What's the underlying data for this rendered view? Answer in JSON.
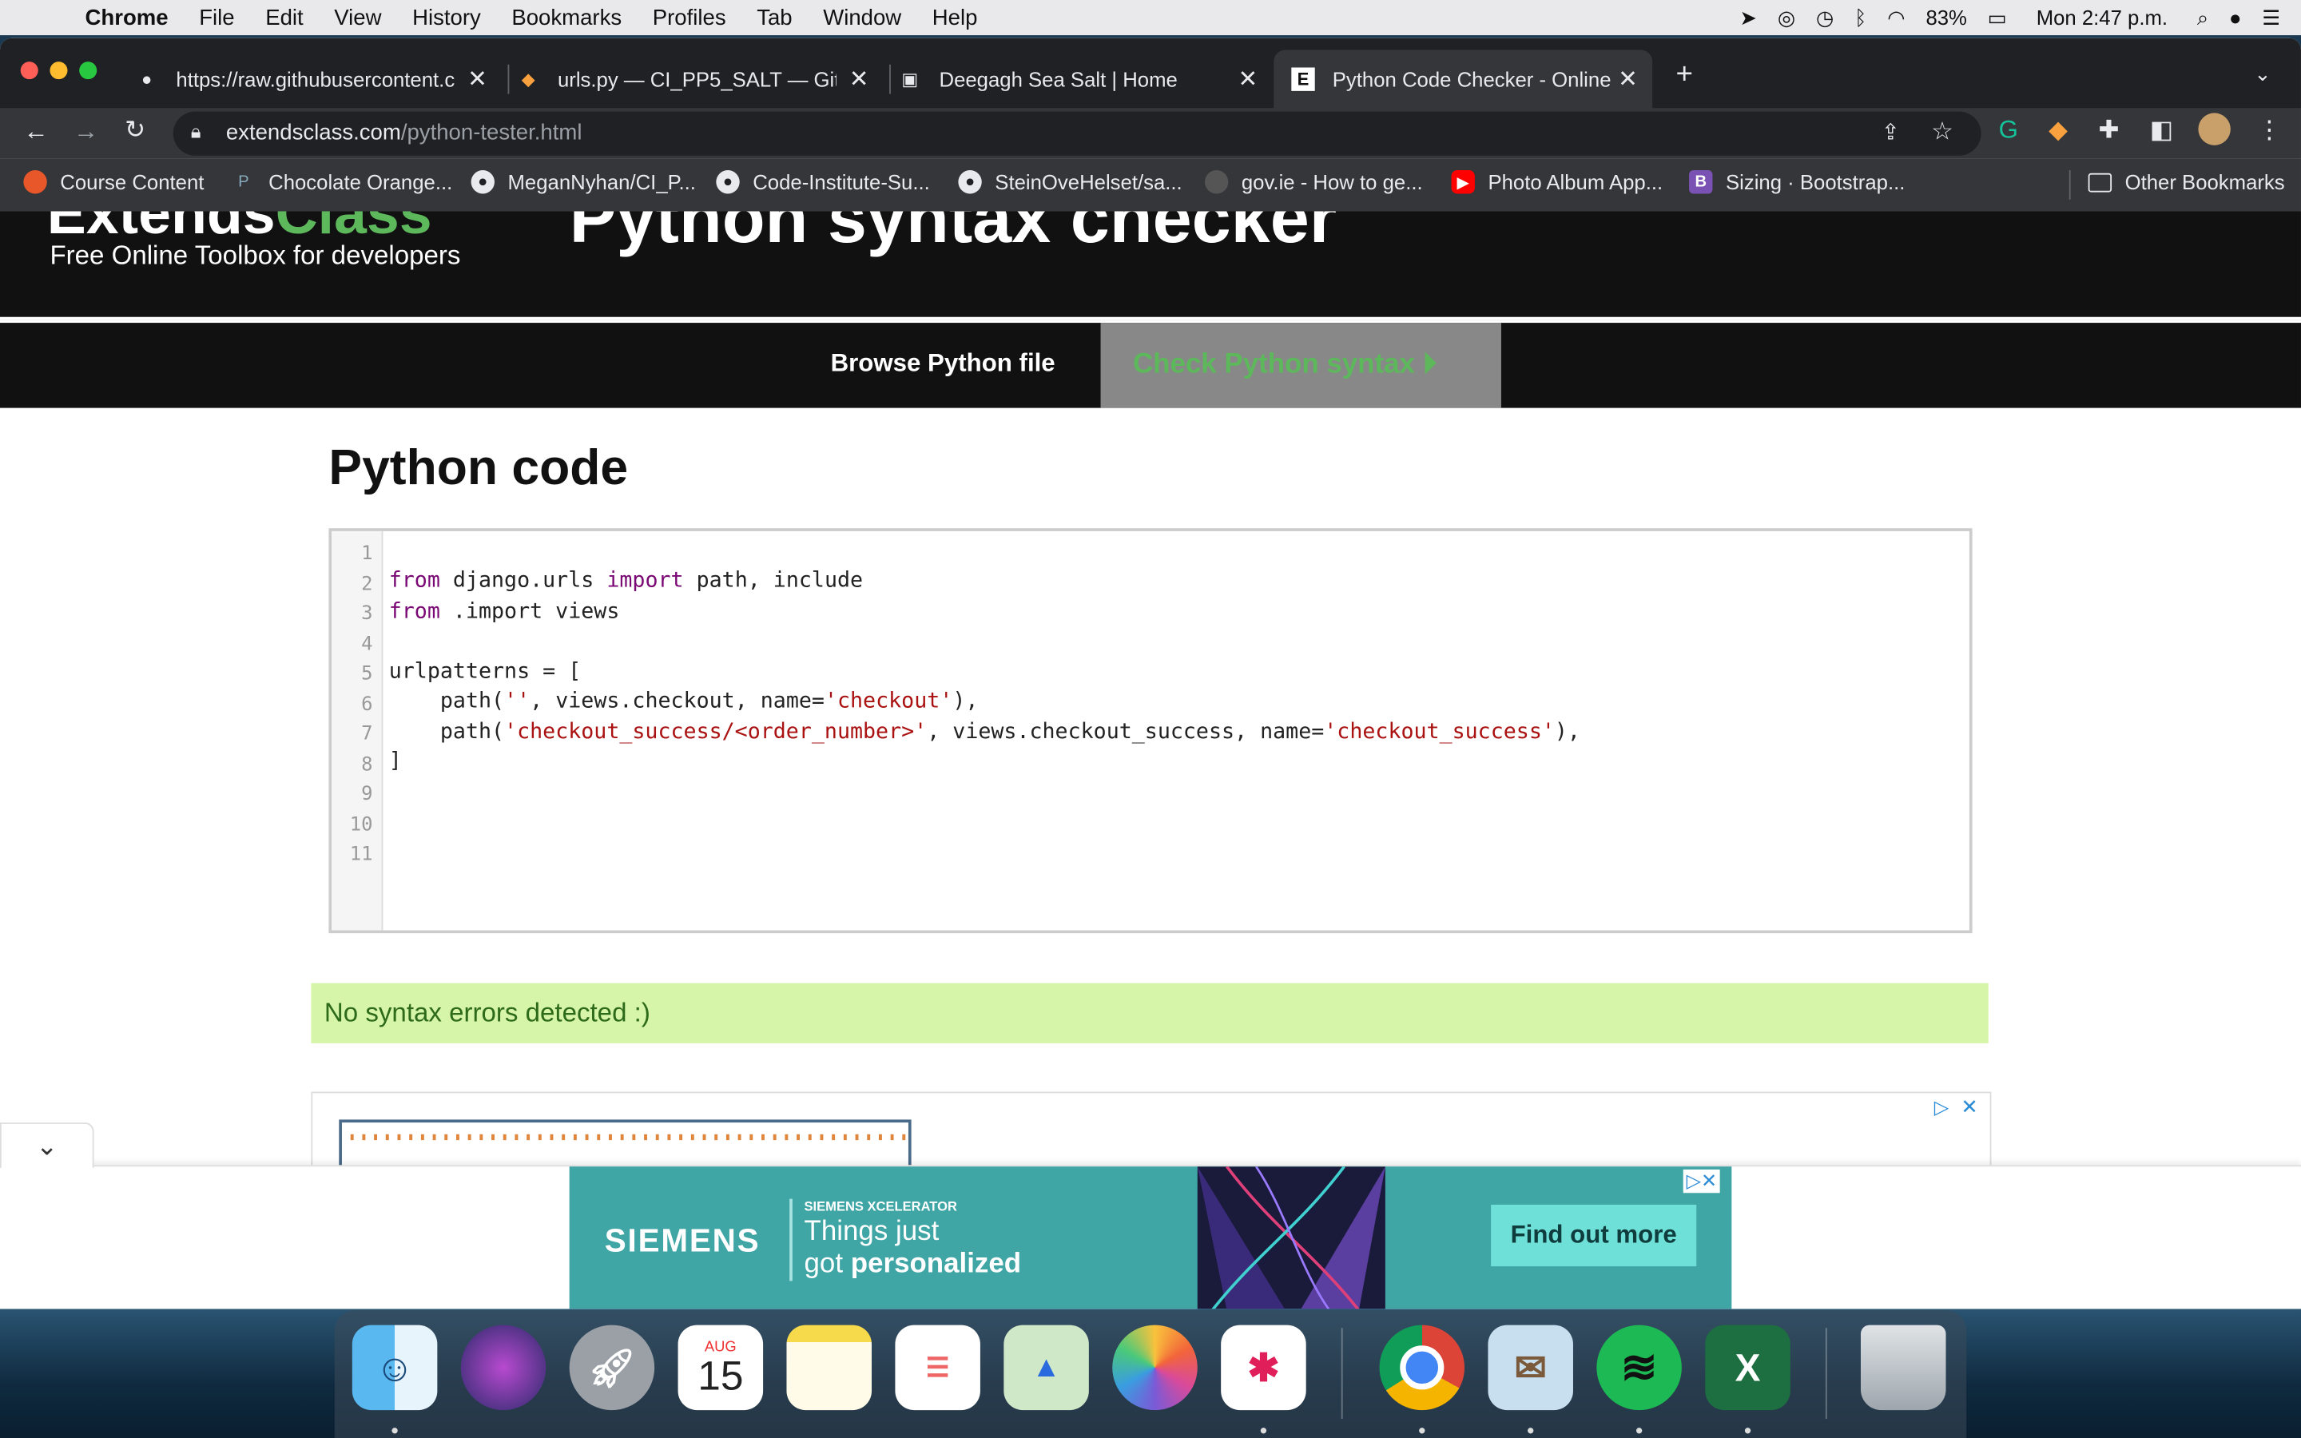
{
  "menubar": {
    "app": "Chrome",
    "items": [
      "File",
      "Edit",
      "View",
      "History",
      "Bookmarks",
      "Profiles",
      "Tab",
      "Window",
      "Help"
    ],
    "battery": "83%",
    "clock": "Mon 2:47 p.m."
  },
  "tabs": [
    {
      "title": "https://raw.githubusercontent.c",
      "icon": "github-icon"
    },
    {
      "title": "urls.py — CI_PP5_SALT — Gitp",
      "icon": "gitpod-icon"
    },
    {
      "title": "Deegagh Sea Salt | Home",
      "icon": "page-icon"
    },
    {
      "title": "Python Code Checker - Online",
      "icon": "extendsclass-icon"
    }
  ],
  "address": {
    "domain": "extendsclass.com",
    "path": "/python-tester.html"
  },
  "bookmarks": [
    "Course Content",
    "Chocolate Orange...",
    "MeganNyhan/CI_P...",
    "Code-Institute-Su...",
    "SteinOveHelset/sa...",
    "gov.ie - How to ge...",
    "Photo Album App...",
    "Sizing · Bootstrap..."
  ],
  "other_bookmarks": "Other Bookmarks",
  "site": {
    "logo_a": "Extends",
    "logo_b": "Class",
    "tagline": "Free Online Toolbox for developers",
    "page_title": "Python syntax checker",
    "browse_label": "Browse Python file",
    "check_label": "Check Python syntax ⏵",
    "section_title": "Python code",
    "result": "No syntax errors detected :)"
  },
  "code_lines": [
    "1",
    "2",
    "3",
    "4",
    "5",
    "6",
    "7",
    "8",
    "9",
    "10",
    "11"
  ],
  "code": {
    "l2a": "from",
    "l2b": " django.urls ",
    "l2c": "import",
    "l2d": " path, include",
    "l3a": "from",
    "l3b": " .import views",
    "l5": "urlpatterns = [",
    "l6a": "    path(",
    "l6b": "''",
    "l6c": ", views.checkout, name=",
    "l6d": "'checkout'",
    "l6e": "),",
    "l7a": "    path(",
    "l7b": "'checkout_success/<order_number>'",
    "l7c": ", views.checkout_success, name=",
    "l7d": "'checkout_success'",
    "l7e": "),",
    "l8": "]"
  },
  "ad": {
    "brand": "SIEMENS",
    "sub": "SIEMENS XCELERATOR",
    "line1": "Things just",
    "line2a": "got ",
    "line2b": "personalized",
    "cta": "Find out more"
  },
  "dock": {
    "calendar_month": "AUG",
    "calendar_day": "15"
  },
  "colors": {
    "accent_green": "#5db85c",
    "result_bg": "#d6f5a9",
    "siemens_teal": "#3fa5a5"
  }
}
